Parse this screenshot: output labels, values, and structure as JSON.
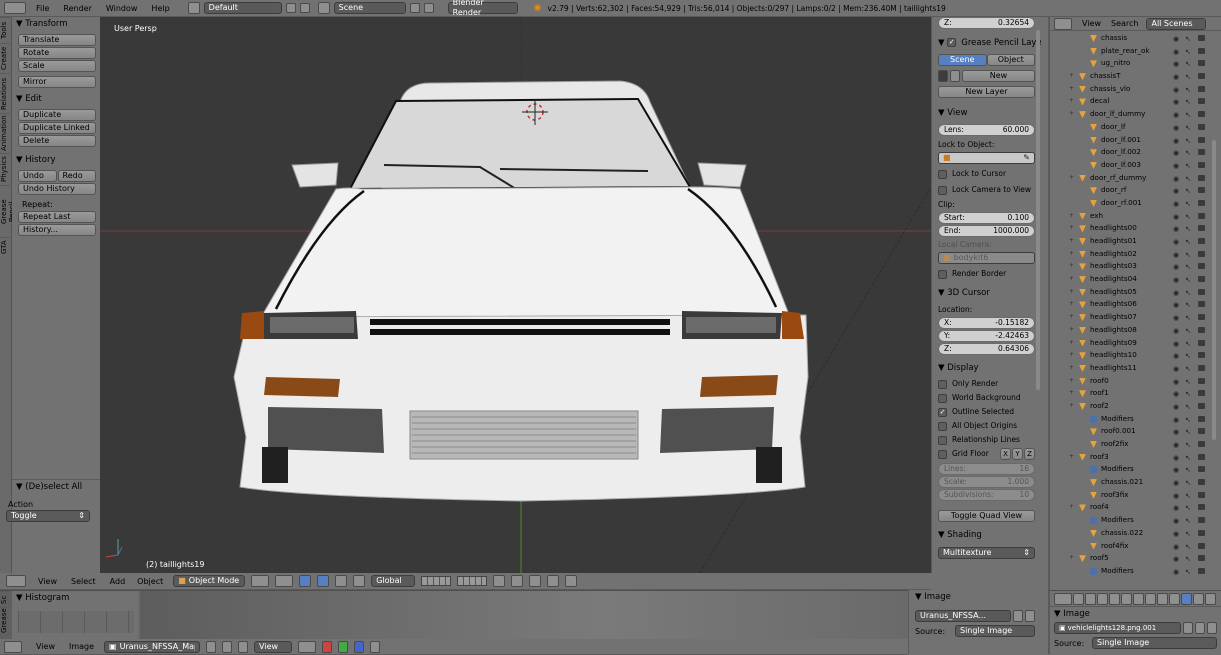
{
  "topbar": {
    "menus": [
      "File",
      "Render",
      "Window",
      "Help"
    ],
    "layout": "Default",
    "scene": "Scene",
    "engine": "Blender Render",
    "stats": "v2.79 | Verts:62,302 | Faces:54,929 | Tris:56,014 | Objects:0/297 | Lamps:0/2 | Mem:236.40M | taillights19"
  },
  "toolshelf": {
    "tabs": [
      "Tools",
      "Create",
      "Relations",
      "Animation",
      "Physics",
      "Grease Pencil",
      "GTA"
    ],
    "transform_header": "Transform",
    "transform_buttons": [
      "Translate",
      "Rotate",
      "Scale"
    ],
    "mirror": "Mirror",
    "edit_header": "Edit",
    "edit_buttons": [
      "Duplicate",
      "Duplicate Linked",
      "Delete"
    ],
    "history_header": "History",
    "undo": "Undo",
    "redo": "Redo",
    "undo_history": "Undo History",
    "repeat_label": "Repeat:",
    "repeat_last": "Repeat Last",
    "history_btn": "History...",
    "op_header": "(De)select All",
    "action_label": "Action",
    "action_value": "Toggle"
  },
  "viewport": {
    "view_name": "User Persp",
    "object_label": "(2) taillights19"
  },
  "viewport_header": {
    "menus": [
      "View",
      "Select",
      "Add",
      "Object"
    ],
    "mode": "Object Mode",
    "orientation": "Global"
  },
  "properties": {
    "z_top_label": "Z:",
    "z_top_value": "0.32654",
    "grease_label": "Grease Pencil Layers",
    "scene_tab": "Scene",
    "object_tab": "Object",
    "new_btn": "New",
    "new_layer_btn": "New Layer",
    "view_header": "View",
    "lens_label": "Lens:",
    "lens_value": "60.000",
    "lock_obj_label": "Lock to Object:",
    "lock_cursor": "Lock to Cursor",
    "lock_camera": "Lock Camera to View",
    "clip_label": "Clip:",
    "clip_start_label": "Start:",
    "clip_start": "0.100",
    "clip_end_label": "End:",
    "clip_end": "1000.000",
    "local_camera_label": "Local Camera:",
    "local_camera": "bodykit6",
    "render_border": "Render Border",
    "cursor_header": "3D Cursor",
    "location_label": "Location:",
    "cursor_x_label": "X:",
    "cursor_x": "-0.15182",
    "cursor_y_label": "Y:",
    "cursor_y": "-2.42463",
    "cursor_z_label": "Z:",
    "cursor_z": "0.64306",
    "display_header": "Display",
    "only_render": "Only Render",
    "world_bg": "World Background",
    "outline_sel": "Outline Selected",
    "all_origins": "All Object Origins",
    "rel_lines": "Relationship Lines",
    "grid_floor": "Grid Floor",
    "axis_x": "X",
    "axis_y": "Y",
    "axis_z": "Z",
    "lines_label": "Lines:",
    "lines": "16",
    "scale_label": "Scale:",
    "scale": "1.000",
    "subdiv_label": "Subdivisions:",
    "subdiv": "10",
    "quad_view": "Toggle Quad View",
    "shading_header": "Shading",
    "shading_value": "Multitexture"
  },
  "outliner": {
    "view": "View",
    "search": "Search",
    "scenes": "All Scenes",
    "rows": [
      {
        "name": "chassis",
        "indent": 2
      },
      {
        "name": "plate_rear_ok",
        "indent": 2
      },
      {
        "name": "ug_nitro",
        "indent": 2
      },
      {
        "name": "chassisT",
        "indent": 1
      },
      {
        "name": "chassis_vlo",
        "indent": 1
      },
      {
        "name": "decal",
        "indent": 1
      },
      {
        "name": "door_lf_dummy",
        "indent": 1
      },
      {
        "name": "door_lf",
        "indent": 2
      },
      {
        "name": "door_lf.001",
        "indent": 2
      },
      {
        "name": "door_lf.002",
        "indent": 2
      },
      {
        "name": "door_lf.003",
        "indent": 2
      },
      {
        "name": "door_rf_dummy",
        "indent": 1
      },
      {
        "name": "door_rf",
        "indent": 2
      },
      {
        "name": "door_rf.001",
        "indent": 2
      },
      {
        "name": "exh",
        "indent": 1
      },
      {
        "name": "headlights00",
        "indent": 1
      },
      {
        "name": "headlights01",
        "indent": 1
      },
      {
        "name": "headlights02",
        "indent": 1
      },
      {
        "name": "headlights03",
        "indent": 1
      },
      {
        "name": "headlights04",
        "indent": 1
      },
      {
        "name": "headlights05",
        "indent": 1
      },
      {
        "name": "headlights06",
        "indent": 1
      },
      {
        "name": "headlights07",
        "indent": 1
      },
      {
        "name": "headlights08",
        "indent": 1
      },
      {
        "name": "headlights09",
        "indent": 1
      },
      {
        "name": "headlights10",
        "indent": 1
      },
      {
        "name": "headlights11",
        "indent": 1
      },
      {
        "name": "roof0",
        "indent": 1
      },
      {
        "name": "roof1",
        "indent": 1
      },
      {
        "name": "roof2",
        "indent": 1
      },
      {
        "name": "Modifiers",
        "indent": 2
      },
      {
        "name": "roof0.001",
        "indent": 2
      },
      {
        "name": "roof2fix",
        "indent": 2
      },
      {
        "name": "roof3",
        "indent": 1
      },
      {
        "name": "Modifiers",
        "indent": 2
      },
      {
        "name": "chassis.021",
        "indent": 2
      },
      {
        "name": "roof3fix",
        "indent": 2
      },
      {
        "name": "roof4",
        "indent": 1
      },
      {
        "name": "Modifiers",
        "indent": 2
      },
      {
        "name": "chassis.022",
        "indent": 2
      },
      {
        "name": "roof4fix",
        "indent": 2
      },
      {
        "name": "roof5",
        "indent": 1
      },
      {
        "name": "Modifiers",
        "indent": 2
      }
    ]
  },
  "bottom_left": {
    "tab1": "Sc",
    "tab2": "Grease",
    "histogram": "Histogram",
    "menus": [
      "View",
      "Image"
    ],
    "image_name": "Uranus_NFSSA_Map..."
  },
  "bottom_mid": {
    "image_header": "Image",
    "image_name": "Uranus_NFSSA...",
    "source_label": "Source:",
    "source_value": "Single Image"
  },
  "bottom_right": {
    "image_header": "Image",
    "image_name": "vehiclelights128.png.001",
    "source_label": "Source:",
    "source_value": "Single Image"
  }
}
